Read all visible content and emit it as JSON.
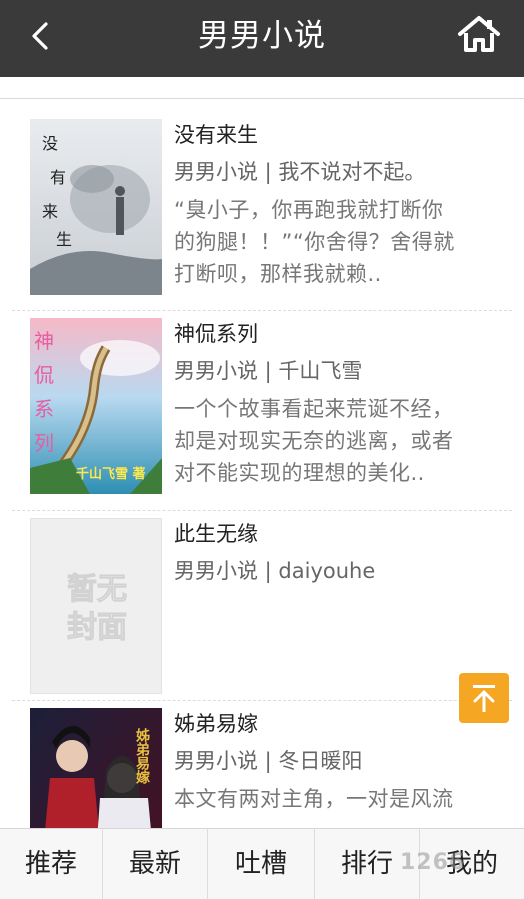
{
  "header": {
    "title": "男男小说",
    "back_icon": "chevron-left-icon",
    "home_icon": "home-icon"
  },
  "books": [
    {
      "title": "没有来生",
      "meta": "男男小说 | 我不说对不起。",
      "desc_lines": [
        "“臭小子，你再跑我就打断你",
        "的狗腿！！”“你舍得？舍得就",
        "打断呗，那样我就赖.."
      ],
      "cover_text": [
        "没",
        "有",
        "来",
        "生"
      ]
    },
    {
      "title": "神侃系列",
      "meta": "男男小说 | 千山飞雪",
      "desc_lines": [
        "一个个故事看起来荒诞不经，",
        "却是对现实无奈的逃离，或者",
        "对不能实现的理想的美化.."
      ],
      "cover_text": [
        "神",
        "侃",
        "系",
        "列"
      ],
      "cover_caption": "千山飞雪 著"
    },
    {
      "title": "此生无缘",
      "meta": "男男小说 | daiyouhe",
      "desc_lines": [],
      "cover_text": [
        "暂无",
        "封面"
      ]
    },
    {
      "title": "姊弟易嫁",
      "meta": "男男小说 | 冬日暖阳",
      "desc_lines": [
        "本文有两对主角，一对是风流"
      ],
      "cover_text": [
        "姊弟易嫁"
      ]
    }
  ],
  "back_to_top_icon": "arrow-up-to-top-icon",
  "tabs": [
    "推荐",
    "最新",
    "吐槽",
    "排行",
    "我的"
  ],
  "watermark": "1266",
  "colors": {
    "header_bg": "#3a3a3a",
    "accent_orange": "#f5a623"
  }
}
